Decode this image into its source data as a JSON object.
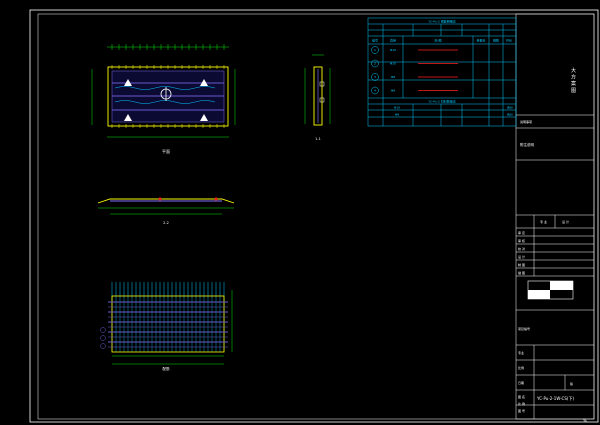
{
  "sheet": {
    "number": "%",
    "drawing_no": "YC-Pu-2-1W-CS(下)",
    "issue_label": "版",
    "approval_rows": [
      "审 定",
      "审 核",
      "校 对",
      "设 计",
      "制 图",
      "描 图"
    ],
    "block_labels": [
      "项目编号",
      "专业",
      "比例",
      "日期"
    ],
    "bottom_labels": [
      "图 名",
      "比 例",
      "图 号"
    ],
    "top_header_left": "专 业",
    "top_header_right": "设 计",
    "vertical_title": "大 方 案 图",
    "side_note": "说明事项",
    "side_heading": "附注说明"
  },
  "table": {
    "title": "YC-Pu-2 钢筋明细表",
    "sub_title": "YC-Pu-2 材料数量表",
    "headers": [
      "编号",
      "直径",
      "简 图",
      "单根长",
      "根数",
      "共长"
    ],
    "rows": [
      {
        "no": "1",
        "dia": "Φ10"
      },
      {
        "no": "2",
        "dia": "Φ10"
      },
      {
        "no": "3",
        "dia": "Φ8"
      },
      {
        "no": "4",
        "dia": "Φ8"
      }
    ],
    "summary_rows": [
      {
        "label": "Φ10",
        "value": "合计"
      },
      {
        "label": "Φ8",
        "value": "合计"
      }
    ]
  },
  "views": {
    "plan_label": "平面",
    "side_label": "1-1",
    "elevation_label": "2-2",
    "rebar_label": "配筋"
  },
  "colors": {
    "border": "#ffffff",
    "table": "#00c8ff",
    "outline": "#ffff00",
    "green": "#00e600",
    "rebar": "#6a5acd",
    "accent": "#ff2020",
    "rebar_cyan": "#00c8ff"
  }
}
